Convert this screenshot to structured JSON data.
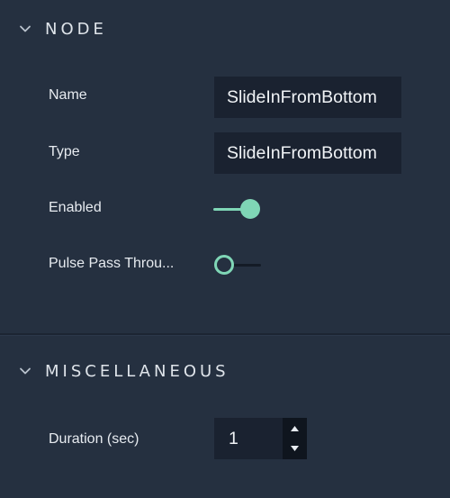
{
  "node_section": {
    "title": "NODE",
    "expanded": true,
    "name": {
      "label": "Name",
      "value": "SlideInFromBottom"
    },
    "type": {
      "label": "Type",
      "value": "SlideInFromBottom"
    },
    "enabled": {
      "label": "Enabled",
      "checked": true
    },
    "pulse_pass_through": {
      "label": "Pulse Pass Throu...",
      "checked": false
    }
  },
  "misc_section": {
    "title": "MISCELLANEOUS",
    "expanded": true,
    "duration": {
      "label": "Duration (sec)",
      "value": "1"
    }
  },
  "colors": {
    "background": "#253040",
    "field_background": "#1a2230",
    "accent": "#7fd6b6",
    "text": "#e7ebf0"
  },
  "icons": {
    "section_toggle": "chevron-down-icon",
    "spinner_up": "triangle-up-icon",
    "spinner_down": "triangle-down-icon"
  }
}
